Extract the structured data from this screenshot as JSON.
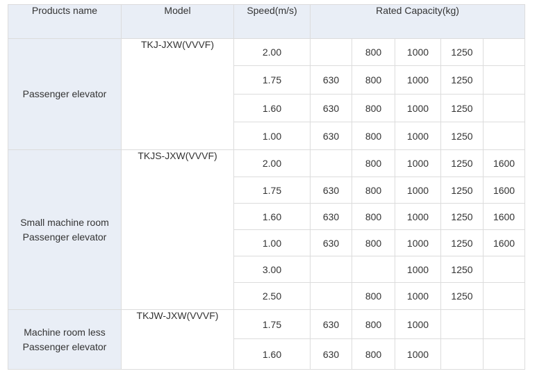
{
  "table": {
    "headers": {
      "products_name": "Products name",
      "model": "Model",
      "speed": "Speed(m/s)",
      "capacity": "Rated Capacity(kg)"
    },
    "groups": [
      {
        "product": [
          "Passenger elevator"
        ],
        "model": "TKJ-JXW(VVVF)",
        "rows": [
          {
            "speed": "2.00",
            "caps": [
              "",
              "800",
              "1000",
              "1250",
              ""
            ]
          },
          {
            "speed": "1.75",
            "caps": [
              "630",
              "800",
              "1000",
              "1250",
              ""
            ]
          },
          {
            "speed": "1.60",
            "caps": [
              "630",
              "800",
              "1000",
              "1250",
              ""
            ]
          },
          {
            "speed": "1.00",
            "caps": [
              "630",
              "800",
              "1000",
              "1250",
              ""
            ]
          }
        ]
      },
      {
        "product": [
          "Small machine room",
          "Passenger elevator"
        ],
        "model": "TKJS-JXW(VVVF)",
        "rows": [
          {
            "speed": "2.00",
            "caps": [
              "",
              "800",
              "1000",
              "1250",
              "1600"
            ]
          },
          {
            "speed": "1.75",
            "caps": [
              "630",
              "800",
              "1000",
              "1250",
              "1600"
            ]
          },
          {
            "speed": "1.60",
            "caps": [
              "630",
              "800",
              "1000",
              "1250",
              "1600"
            ]
          },
          {
            "speed": "1.00",
            "caps": [
              "630",
              "800",
              "1000",
              "1250",
              "1600"
            ]
          },
          {
            "speed": "3.00",
            "caps": [
              "",
              "",
              "1000",
              "1250",
              ""
            ]
          },
          {
            "speed": "2.50",
            "caps": [
              "",
              "800",
              "1000",
              "1250",
              ""
            ]
          }
        ]
      },
      {
        "product": [
          "Machine room less",
          "Passenger elevator"
        ],
        "model": "TKJW-JXW(VVVF)",
        "rows": [
          {
            "speed": "1.75",
            "caps": [
              "630",
              "800",
              "1000",
              "",
              ""
            ]
          },
          {
            "speed": "1.60",
            "caps": [
              "630",
              "800",
              "1000",
              "",
              ""
            ]
          }
        ]
      }
    ]
  },
  "colors": {
    "header_background": "#e9eef6",
    "border": "#dcdcdc",
    "text": "#333333"
  }
}
